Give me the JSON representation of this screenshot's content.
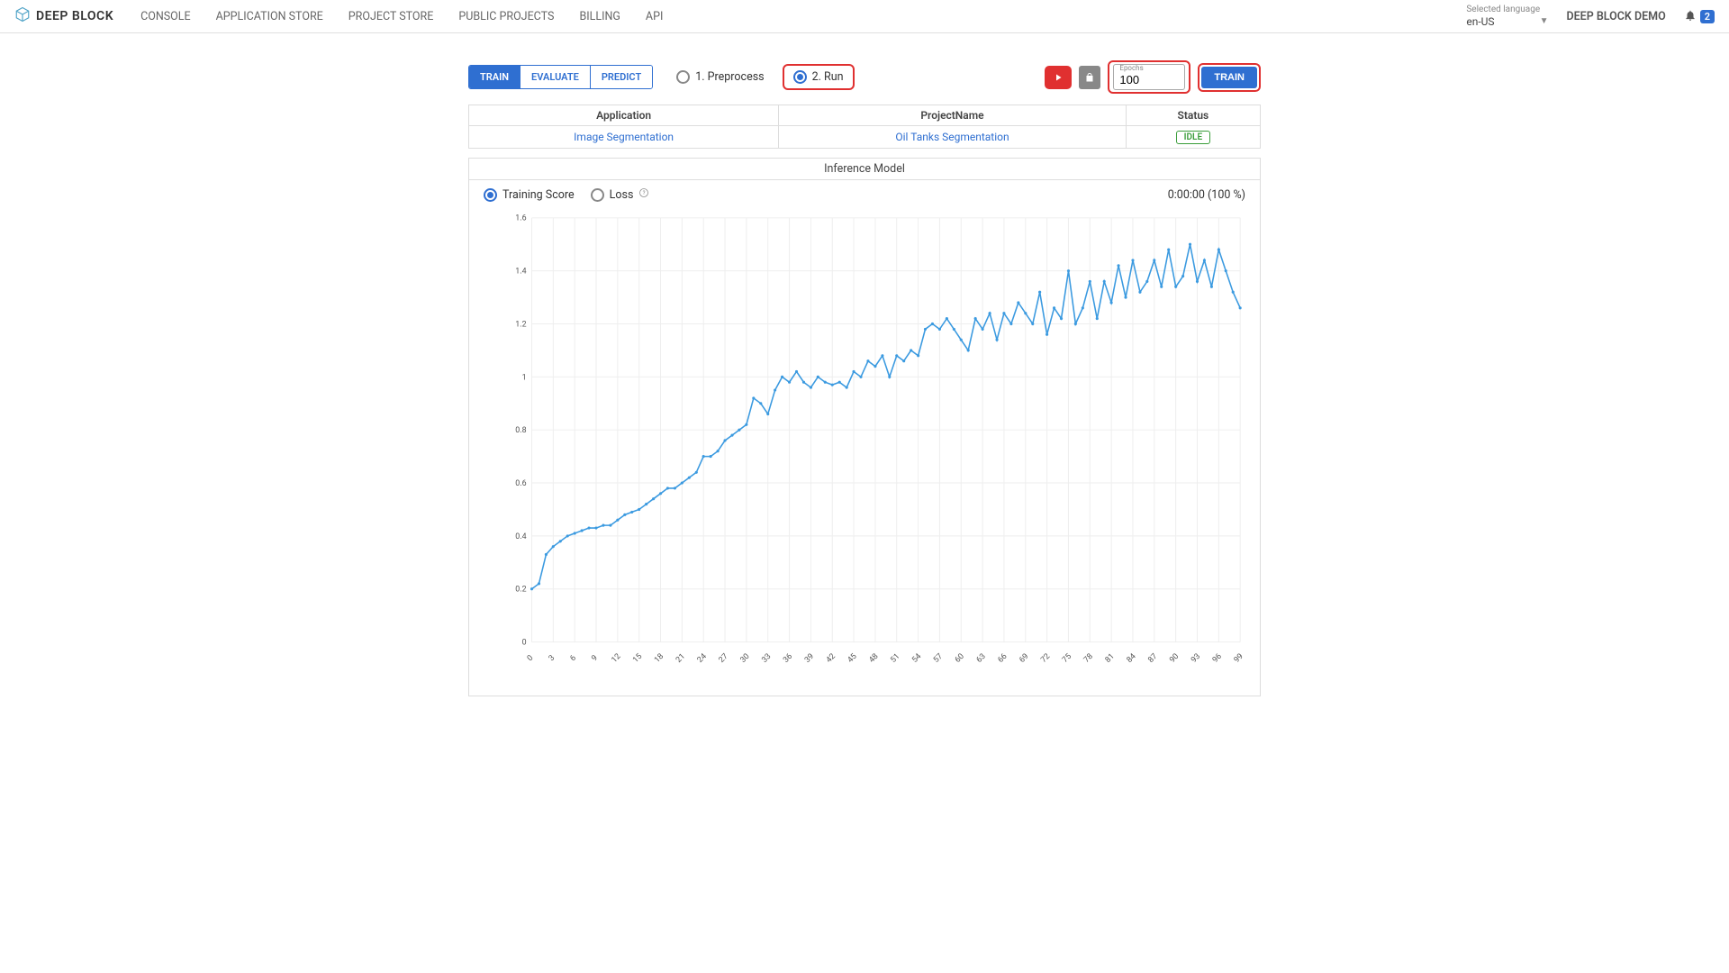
{
  "brand": "DEEP BLOCK",
  "nav": [
    "CONSOLE",
    "APPLICATION STORE",
    "PROJECT STORE",
    "PUBLIC PROJECTS",
    "BILLING",
    "API"
  ],
  "lang_label": "Selected language",
  "lang_value": "en-US",
  "user": "DEEP BLOCK DEMO",
  "notif_count": "2",
  "tabs": {
    "train": "TRAIN",
    "evaluate": "EVALUATE",
    "predict": "PREDICT"
  },
  "steps": {
    "preprocess": "1. Preprocess",
    "run": "2. Run"
  },
  "epochs_label": "Epochs",
  "epochs_value": "100",
  "train_btn": "TRAIN",
  "cols": {
    "app": "Application",
    "proj": "ProjectName",
    "status": "Status"
  },
  "row": {
    "app": "Image Segmentation",
    "proj": "Oil Tanks Segmentation",
    "status": "IDLE"
  },
  "chart_section_title": "Inference Model",
  "metrics": {
    "score": "Training Score",
    "loss": "Loss"
  },
  "timer": "0:00:00 (100 %)",
  "chart_data": {
    "type": "line",
    "title": "Inference Model",
    "xlabel": "",
    "ylabel": "",
    "ylim": [
      0,
      1.6
    ],
    "x": [
      0,
      1,
      2,
      3,
      4,
      5,
      6,
      7,
      8,
      9,
      10,
      11,
      12,
      13,
      14,
      15,
      16,
      17,
      18,
      19,
      20,
      21,
      22,
      23,
      24,
      25,
      26,
      27,
      28,
      29,
      30,
      31,
      32,
      33,
      34,
      35,
      36,
      37,
      38,
      39,
      40,
      41,
      42,
      43,
      44,
      45,
      46,
      47,
      48,
      49,
      50,
      51,
      52,
      53,
      54,
      55,
      56,
      57,
      58,
      59,
      60,
      61,
      62,
      63,
      64,
      65,
      66,
      67,
      68,
      69,
      70,
      71,
      72,
      73,
      74,
      75,
      76,
      77,
      78,
      79,
      80,
      81,
      82,
      83,
      84,
      85,
      86,
      87,
      88,
      89,
      90,
      91,
      92,
      93,
      94,
      95,
      96,
      97,
      98,
      99
    ],
    "values": [
      0.2,
      0.22,
      0.33,
      0.36,
      0.38,
      0.4,
      0.41,
      0.42,
      0.43,
      0.43,
      0.44,
      0.44,
      0.46,
      0.48,
      0.49,
      0.5,
      0.52,
      0.54,
      0.56,
      0.58,
      0.58,
      0.6,
      0.62,
      0.64,
      0.7,
      0.7,
      0.72,
      0.76,
      0.78,
      0.8,
      0.82,
      0.92,
      0.9,
      0.86,
      0.95,
      1.0,
      0.98,
      1.02,
      0.98,
      0.96,
      1.0,
      0.98,
      0.97,
      0.98,
      0.96,
      1.02,
      1.0,
      1.06,
      1.04,
      1.08,
      1.0,
      1.08,
      1.06,
      1.1,
      1.08,
      1.18,
      1.2,
      1.18,
      1.22,
      1.18,
      1.14,
      1.1,
      1.22,
      1.18,
      1.24,
      1.14,
      1.24,
      1.2,
      1.28,
      1.24,
      1.2,
      1.32,
      1.16,
      1.26,
      1.22,
      1.4,
      1.2,
      1.26,
      1.36,
      1.22,
      1.36,
      1.28,
      1.42,
      1.3,
      1.44,
      1.32,
      1.36,
      1.44,
      1.34,
      1.48,
      1.34,
      1.38,
      1.5,
      1.36,
      1.44,
      1.34,
      1.48,
      1.4,
      1.32,
      1.26
    ],
    "y_ticks": [
      0,
      0.2,
      0.4,
      0.6,
      0.8,
      1.0,
      1.2,
      1.4,
      1.6
    ],
    "x_ticks": [
      0,
      3,
      6,
      9,
      12,
      15,
      18,
      21,
      24,
      27,
      30,
      33,
      36,
      39,
      42,
      45,
      48,
      51,
      54,
      57,
      60,
      63,
      66,
      69,
      72,
      75,
      78,
      81,
      84,
      87,
      90,
      93,
      96,
      99
    ]
  }
}
